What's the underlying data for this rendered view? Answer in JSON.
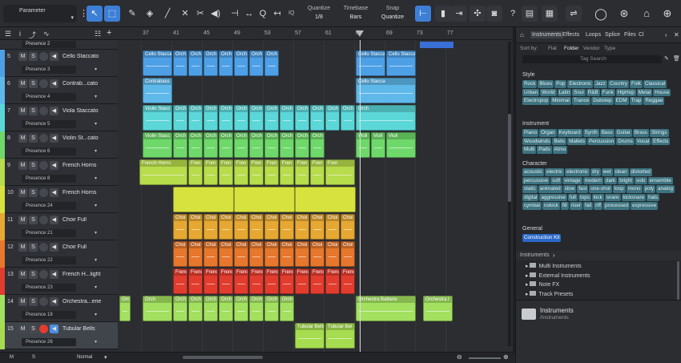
{
  "toolbar": {
    "parameter_label": "Parameter",
    "quantize": {
      "label": "Quantize",
      "value": "1/8"
    },
    "timebase": {
      "label": "Timebase",
      "value": "Bars"
    },
    "snap": {
      "label": "Snap",
      "value": "Quantize"
    },
    "iq_label": "IQ"
  },
  "ruler": {
    "bars": [
      "37",
      "41",
      "45",
      "49",
      "53",
      "57",
      "61",
      "65",
      "69",
      "73",
      "77"
    ]
  },
  "tracks": [
    {
      "num": "5",
      "name": "Cello Staccato",
      "preset": "Presence 3",
      "color": "#4ea0e6"
    },
    {
      "num": "6",
      "name": "Contrab...cato",
      "preset": "Presence 4",
      "color": "#5fb8ea"
    },
    {
      "num": "7",
      "name": "Viola Staccato",
      "preset": "Presence 5",
      "color": "#5cd7d8"
    },
    {
      "num": "8",
      "name": "Violin St...cato",
      "preset": "Presence 6",
      "color": "#6fd86a"
    },
    {
      "num": "9",
      "name": "French Horns",
      "preset": "Presence 8",
      "color": "#b7dc4c"
    },
    {
      "num": "10",
      "name": "French Horns",
      "preset": "Presence 24",
      "color": "#d7e23e"
    },
    {
      "num": "11",
      "name": "Choir Full",
      "preset": "Presence 21",
      "color": "#e6a832"
    },
    {
      "num": "12",
      "name": "Choir Full",
      "preset": "Presence 22",
      "color": "#e6772c"
    },
    {
      "num": "13",
      "name": "French H...light",
      "preset": "Presence 23",
      "color": "#e23c2e"
    },
    {
      "num": "14",
      "name": "Orchestra...erie",
      "preset": "Presence 18",
      "color": "#a3e060"
    },
    {
      "num": "15",
      "name": "Tubular Bells",
      "preset": "Presence 26",
      "color": "#a6dc50"
    }
  ],
  "top_partial_preset": "Presence 2",
  "clips": {
    "cello": [
      "Cello Stacca",
      "Orch",
      "Orch",
      "Orch",
      "Orch",
      "Orch",
      "Orch",
      "Orch",
      "Cello Stacca",
      "Cello Stacca"
    ],
    "contrabass": [
      "Contrabass",
      "Cello Stacca"
    ],
    "viola": [
      "Violin Stacc",
      "Orch",
      "Orch",
      "Orch",
      "Orch",
      "Orch",
      "Orch",
      "Orch",
      "Orch",
      "Orch",
      "Orch",
      "Orch",
      "Orch",
      "Orch"
    ],
    "violin": [
      "Violin Stacc",
      "Orch",
      "Orch",
      "Orch",
      "Orch",
      "Orch",
      "Orch",
      "Orch",
      "Orch",
      "Orch",
      "Orch",
      "Violi",
      "Violi",
      "Violi"
    ],
    "horns": [
      "French Horns",
      "Fren",
      "Fren",
      "Fren",
      "Fren",
      "Fren",
      "Fren",
      "Fren",
      "Fren",
      "Fren",
      "Fren"
    ],
    "choir": [
      "Choi",
      "Choi",
      "Choi",
      "Choi",
      "Choi",
      "Choi",
      "Choi",
      "Choi",
      "Choi",
      "Choi",
      "Choi",
      "Choi"
    ],
    "highlight": [
      "Frenc",
      "Frenc",
      "Frenc",
      "Frenc",
      "Frenc",
      "Frenc",
      "Frenc",
      "Frenc",
      "Frenc",
      "Frenc",
      "Frenc",
      "Frenc"
    ],
    "orch": [
      "Orch",
      "Orch",
      "Orch",
      "Orch",
      "Orch",
      "Orch",
      "Orch",
      "Orch",
      "Orch",
      "Orch",
      "Orchestra Batterie",
      "Orchestra I"
    ],
    "bells": [
      "Tubular Bells",
      "Tubular Bel"
    ]
  },
  "footer": {
    "m": "M",
    "s": "S",
    "mode": "Normal"
  },
  "browser": {
    "tabs": [
      "Instruments",
      "Effects",
      "Loops",
      "Splice",
      "Files",
      "Cl"
    ],
    "sort_by": "Sort by:",
    "sort_options": [
      "Flat",
      "Folder",
      "Vendor",
      "Type"
    ],
    "search_placeholder": "Tag Search",
    "style_title": "Style",
    "style_tags": [
      "Rock",
      "Blues",
      "Pop",
      "Electronic",
      "Jazz",
      "Country",
      "Folk",
      "Classical",
      "Urban",
      "World",
      "Latin",
      "Soul",
      "R&B",
      "Funk",
      "HipHop",
      "Metal",
      "House",
      "Electropop",
      "Minimal",
      "Trance",
      "Dubstep",
      "EDM",
      "Trap",
      "Reggae"
    ],
    "instrument_title": "Instrument",
    "instrument_tags": [
      "Piano",
      "Organ",
      "Keyboard",
      "Synth",
      "Bass",
      "Guitar",
      "Brass",
      "Strings",
      "Woodwinds",
      "Bells",
      "Mallets",
      "Percussion",
      "Drums",
      "Vocal",
      "Effects",
      "Multi",
      "Pads",
      "Atmo"
    ],
    "character_title": "Character",
    "character_tags": [
      "acoustic",
      "electric",
      "electronic",
      "dry",
      "wet",
      "clean",
      "distorted",
      "percussive",
      "soft",
      "vintage",
      "modern",
      "dark",
      "bright",
      "solo",
      "ensemble",
      "static",
      "animated",
      "slow",
      "fast",
      "one-shot",
      "loop",
      "mono",
      "poly",
      "analog",
      "digital",
      "aggressive",
      "full",
      "tops",
      "kick",
      "snare",
      "kicksnare",
      "hats",
      "cymbal",
      "nokick",
      "fill",
      "riser",
      "fall",
      "riff",
      "processed",
      "expressive"
    ],
    "general_title": "General",
    "general_tags": [
      "Construction Kit"
    ],
    "breadcrumb": "Instruments",
    "tree": [
      "Multi Instruments",
      "External Instruments",
      "Note FX",
      "Track Presets"
    ],
    "footer_title": "Instruments",
    "footer_path": "/Instruments"
  }
}
